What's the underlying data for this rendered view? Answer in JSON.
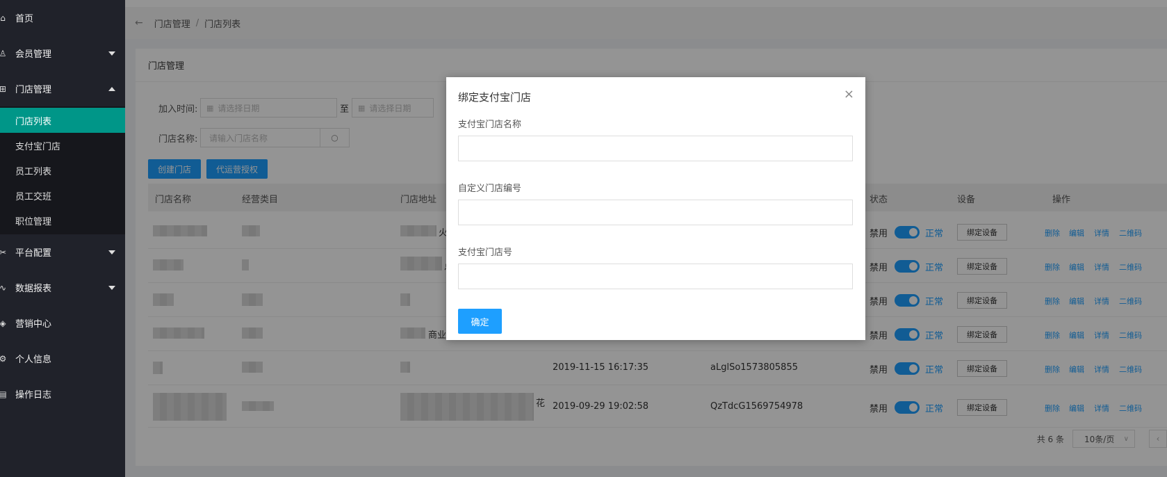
{
  "sidebar": {
    "items": [
      {
        "label": "首页",
        "icon": "home-icon"
      },
      {
        "label": "会员管理",
        "icon": "user-icon"
      },
      {
        "label": "门店管理",
        "icon": "store-icon"
      },
      {
        "label": "平台配置",
        "icon": "tools-icon"
      },
      {
        "label": "数据报表",
        "icon": "chart-icon"
      },
      {
        "label": "营销中心",
        "icon": "cube-icon"
      },
      {
        "label": "个人信息",
        "icon": "gear-icon"
      },
      {
        "label": "操作日志",
        "icon": "log-icon"
      }
    ],
    "submenu": [
      "门店列表",
      "支付宝门店",
      "员工列表",
      "员工交班",
      "职位管理"
    ]
  },
  "breadcrumb": {
    "parent": "门店管理",
    "separator": "/",
    "current": "门店列表"
  },
  "card": {
    "title": "门店管理"
  },
  "filters": {
    "join_time_label": "加入时间:",
    "date_placeholder": "请选择日期",
    "to_label": "至",
    "store_name_label": "门店名称:",
    "store_name_placeholder": "请输入门店名称"
  },
  "buttons": {
    "create": "创建门店",
    "authorize": "代运营授权"
  },
  "table": {
    "headers": [
      "门店名称",
      "经营类目",
      "门店地址",
      "状态",
      "设备",
      "操作"
    ],
    "rows": [
      {
        "address_suffix": "火",
        "time": "",
        "code": ""
      },
      {
        "address_suffix": "总",
        "time": "",
        "code": ""
      },
      {
        "address_suffix": "",
        "time": "",
        "code": ""
      },
      {
        "address_suffix": "商业",
        "time": "",
        "code": ""
      },
      {
        "address_suffix": "",
        "time": "2019-11-15 16:17:35",
        "code": "aLglSo1573805855"
      },
      {
        "address_suffix": "花",
        "time": "2019-09-29 19:02:58",
        "code": "QzTdcG1569754978"
      }
    ],
    "status_off": "禁用",
    "status_on": "正常",
    "bind_device": "绑定设备",
    "ops": [
      "删除",
      "编辑",
      "详情",
      "二维码"
    ]
  },
  "pager": {
    "total": "共 6 条",
    "page_size": "10条/页"
  },
  "modal": {
    "title": "绑定支付宝门店",
    "field1_label": "支付宝门店名称",
    "field2_label": "自定义门店编号",
    "field3_label": "支付宝门店号",
    "confirm": "确定"
  }
}
